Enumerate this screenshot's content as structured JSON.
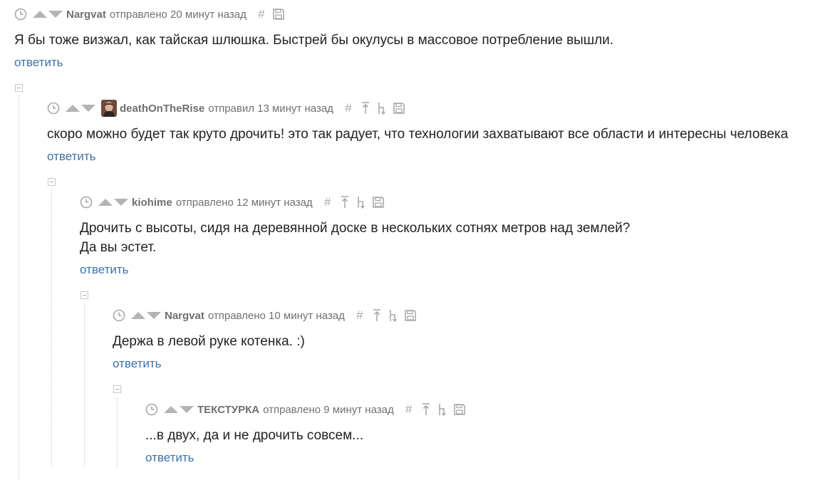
{
  "comments": [
    {
      "author": "Nargvat",
      "sent": "отправлено 20 минут назад",
      "text_lines": [
        "Я бы тоже визжал, как тайская шлюшка. Быстрей бы окулусы в массовое потребление вышли."
      ],
      "reply": "ответить"
    },
    {
      "author": "deathOnTheRise",
      "sent": "отправил 13 минут назад",
      "text_lines": [
        "скоро можно будет так круто дрочить! это так радует, что технологии захватывают все области и интересны человека"
      ],
      "reply": "ответить"
    },
    {
      "author": "kiohime",
      "sent": "отправлено 12 минут назад",
      "text_lines": [
        "Дрочить с высоты, сидя на деревянной доске в нескольких сотнях метров над землей?",
        "Да вы эстет."
      ],
      "reply": "ответить"
    },
    {
      "author": "Nargvat",
      "sent": "отправлено 10 минут назад",
      "text_lines": [
        "Держа в левой руке котенка. :)"
      ],
      "reply": "ответить"
    },
    {
      "author": "ТЕКСТУРКА",
      "sent": "отправлено 9 минут назад",
      "text_lines": [
        "...в двух, да и не дрочить совсем..."
      ],
      "reply": "ответить"
    }
  ],
  "icons": {
    "clock": "clock-icon",
    "vote_up": "arrow-up-icon",
    "vote_down": "arrow-down-icon",
    "permalink": "hash-icon",
    "to_top": "arrow-to-top-icon",
    "to_parent": "arrow-to-parent-icon",
    "save": "save-icon",
    "collapse": "collapse-icon"
  },
  "colors": {
    "link": "#3b73aa",
    "author": "#6f6f6f",
    "icon": "#a9a9a9",
    "text": "#222222"
  }
}
